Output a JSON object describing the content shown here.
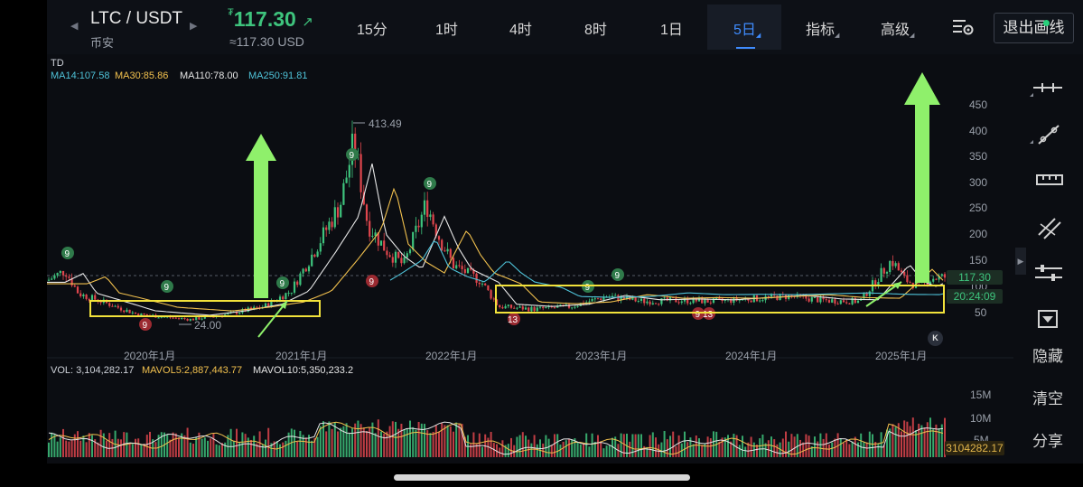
{
  "header": {
    "pair": "LTC / USDT",
    "exchange": "币安",
    "price": "117.30",
    "price_prefix": "₮",
    "price_arrow": "↗",
    "price_usd": "≈117.30 USD",
    "timeframes": [
      "15分",
      "1时",
      "4时",
      "8时",
      "1日",
      "5日"
    ],
    "active_timeframe": "5日",
    "indicator_menu": "指标",
    "advanced_menu": "高级",
    "exit_button": "退出画线"
  },
  "indicators": {
    "td_label": "TD",
    "ma14": "MA14:107.58",
    "ma30": "MA30:85.86",
    "ma110": "MA110:78.00",
    "ma250": "MA250:91.81",
    "vol": "VOL: 3,104,282.17",
    "mavol5": "MAVOL5:2,887,443.77",
    "mavol10": "MAVOL10:5,350,233.2"
  },
  "chart_data": {
    "type": "line",
    "title": "LTC / USDT 5日",
    "price_axis": [
      "450",
      "400",
      "350",
      "300",
      "250",
      "200",
      "150",
      "100",
      "50"
    ],
    "x_ticks": [
      "2020年1月",
      "2021年1月",
      "2022年1月",
      "2023年1月",
      "2024年1月",
      "2025年1月"
    ],
    "volume_axis": [
      "15M",
      "10M",
      "5M"
    ],
    "high_label": "413.49",
    "low_label": "24.00",
    "td_marks_green": [
      "9",
      "9",
      "9",
      "9",
      "9",
      "9",
      "9"
    ],
    "td_marks_red": [
      "9",
      "9",
      "13",
      "9",
      "13"
    ],
    "current_price_tag": "117.30",
    "countdown_tag": "20:24:09",
    "volume_tag": "3104282.17",
    "colors": {
      "up": "#3ec47d",
      "down": "#e0464d",
      "ma14": "#e6e6e6",
      "ma30": "#f2c14e",
      "ma250": "#4fc3d9",
      "annotation_box": "#f2e23b",
      "annotation_arrow": "#8ff06b"
    }
  },
  "toolbar": {
    "hide": "隐藏",
    "clear": "清空",
    "share": "分享"
  },
  "k_button": "K"
}
